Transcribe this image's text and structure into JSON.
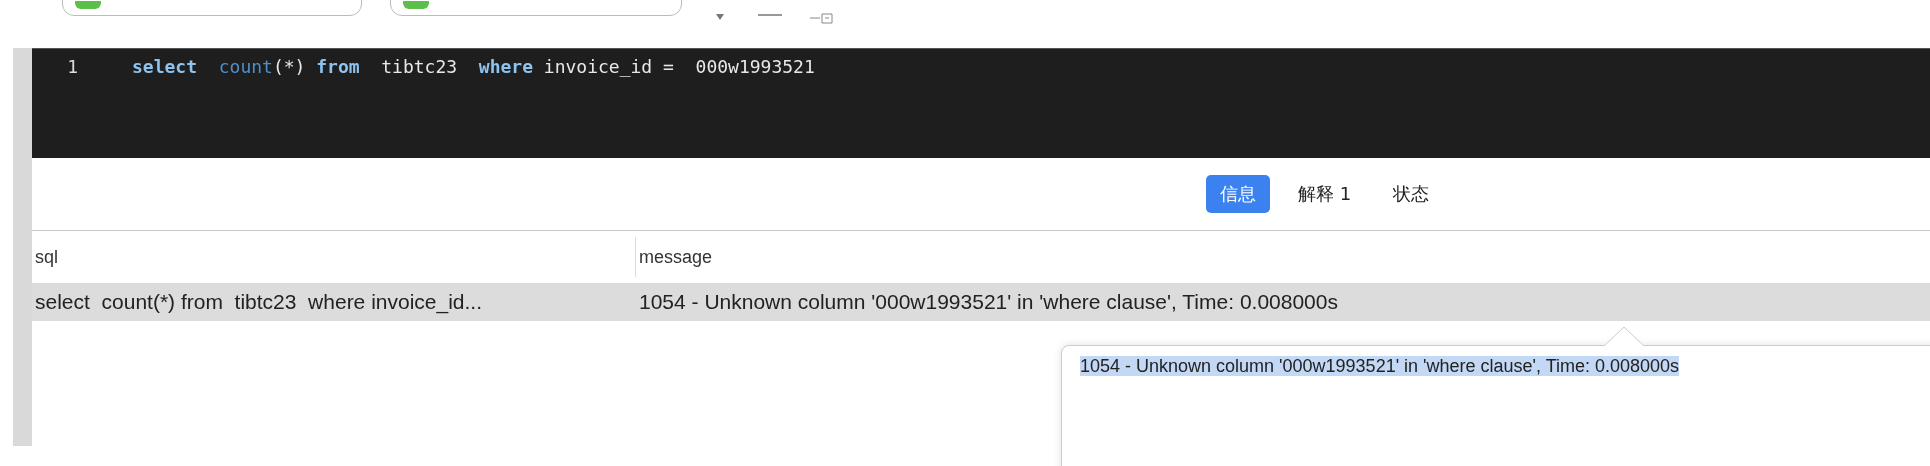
{
  "editor": {
    "lines": [
      {
        "number": "1",
        "tokens": [
          {
            "text": "select",
            "kind": "keyword"
          },
          {
            "text": "  count",
            "kind": "function"
          },
          {
            "text": "(*)",
            "kind": "plain"
          },
          {
            "text": " from",
            "kind": "keyword"
          },
          {
            "text": "  tibtc23",
            "kind": "plain"
          },
          {
            "text": "  where",
            "kind": "keyword"
          },
          {
            "text": " invoice_id =  000w1993521",
            "kind": "plain"
          }
        ]
      }
    ]
  },
  "tabs": [
    {
      "label": "信息",
      "selected": true
    },
    {
      "label": "解释 1",
      "selected": false
    },
    {
      "label": "状态",
      "selected": false
    }
  ],
  "table": {
    "columns": [
      "sql",
      "message"
    ],
    "rows": [
      {
        "cells": [
          "select  count(*) from  tibtc23  where invoice_id...",
          "1054 - Unknown column '000w1993521' in 'where clause', Time: 0.008000s"
        ],
        "selected": true
      }
    ]
  },
  "popover": {
    "text": "1054 - Unknown column '000w1993521' in 'where clause', Time: 0.008000s",
    "selected": true
  }
}
